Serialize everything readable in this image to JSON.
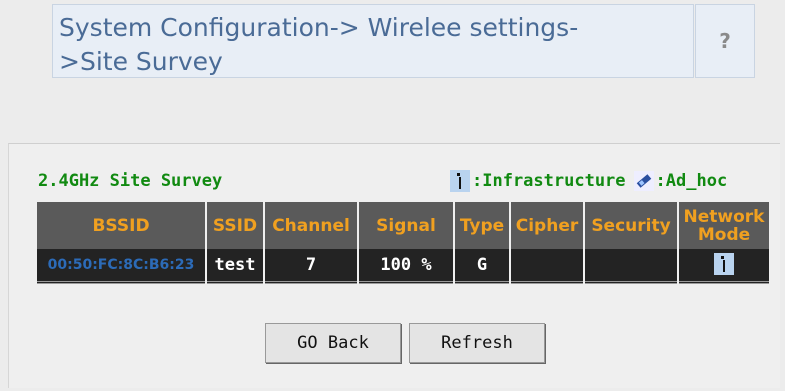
{
  "header": {
    "line1": "System Configuration-> Wirelee settings-",
    "line2": ">Site Survey",
    "help_label": "?"
  },
  "survey": {
    "title": "2.4GHz Site Survey",
    "legend": {
      "infrastructure": ":Infrastructure",
      "adhoc": ":Ad_hoc",
      "infrastructure_icon": "antenna-icon",
      "adhoc_icon": "network-card-icon"
    }
  },
  "table": {
    "headers": {
      "bssid": "BSSID",
      "ssid": "SSID",
      "channel": "Channel",
      "signal": "Signal",
      "type": "Type",
      "cipher": "Cipher",
      "security": "Security",
      "mode_line1": "Network",
      "mode_line2": "Mode"
    },
    "rows": [
      {
        "bssid": "00:50:FC:8C:B6:23",
        "ssid": "test",
        "channel": "7",
        "signal": "100 %",
        "type": "G",
        "cipher": "",
        "security": "",
        "mode_icon": "antenna-icon"
      }
    ]
  },
  "buttons": {
    "back": "GO Back",
    "refresh": "Refresh"
  },
  "colors": {
    "title_green": "#118a11",
    "header_orange": "#f0a020",
    "header_blue": "#4a6b96",
    "bssid_blue": "#2c6bb8"
  }
}
